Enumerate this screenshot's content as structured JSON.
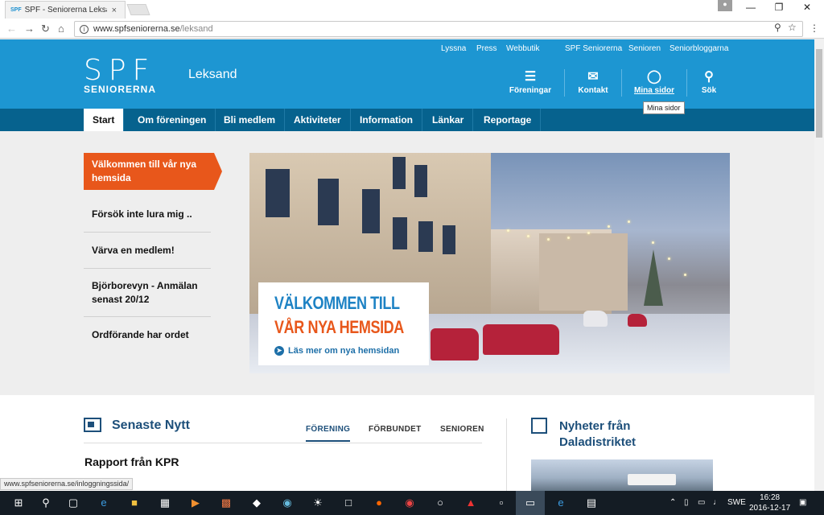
{
  "browser": {
    "tab_favicon": "SPF",
    "tab_title": "SPF - Seniorerna Leksand",
    "tab_close": "×",
    "url_domain": "www.spfseniorerna.se",
    "url_path": "/leksand",
    "status_url": "www.spfseniorerna.se/inloggningssida/"
  },
  "site": {
    "logo_main": "SPF",
    "logo_sub": "SENIORERNA",
    "name": "Leksand",
    "top_links": [
      "Lyssna",
      "Press",
      "Webbutik",
      "SPF Seniorerna",
      "Senioren",
      "Seniorbloggarna"
    ],
    "header_icons": {
      "foreningar": "Föreningar",
      "kontakt": "Kontakt",
      "mina_sidor": "Mina sidor",
      "sok": "Sök"
    },
    "tooltip": "Mina sidor"
  },
  "nav": [
    "Start",
    "Om föreningen",
    "Bli medlem",
    "Aktiviteter",
    "Information",
    "Länkar",
    "Reportage"
  ],
  "sidebar": [
    "Välkommen till vår nya hemsida",
    "Försök inte lura mig ..",
    "Värva en medlem!",
    "Björborevyn - Anmälan senast 20/12",
    "Ordförande har ordet"
  ],
  "hero": {
    "line1": "VÄLKOMMEN TILL",
    "line2": "VÅR NYA HEMSIDA",
    "link": "Läs mer om nya hemsidan"
  },
  "news": {
    "title": "Senaste Nytt",
    "tabs": [
      "FÖRENING",
      "FÖRBUNDET",
      "SENIOREN"
    ],
    "article_title": "Rapport från KPR"
  },
  "district": {
    "title": "Nyheter från Daladistriktet"
  },
  "taskbar": {
    "lang": "SWE",
    "time": "16:28",
    "date": "2016-12-17"
  },
  "colors": {
    "header_blue": "#1d96d2",
    "nav_dark": "#06628e",
    "accent_orange": "#e8571b"
  }
}
